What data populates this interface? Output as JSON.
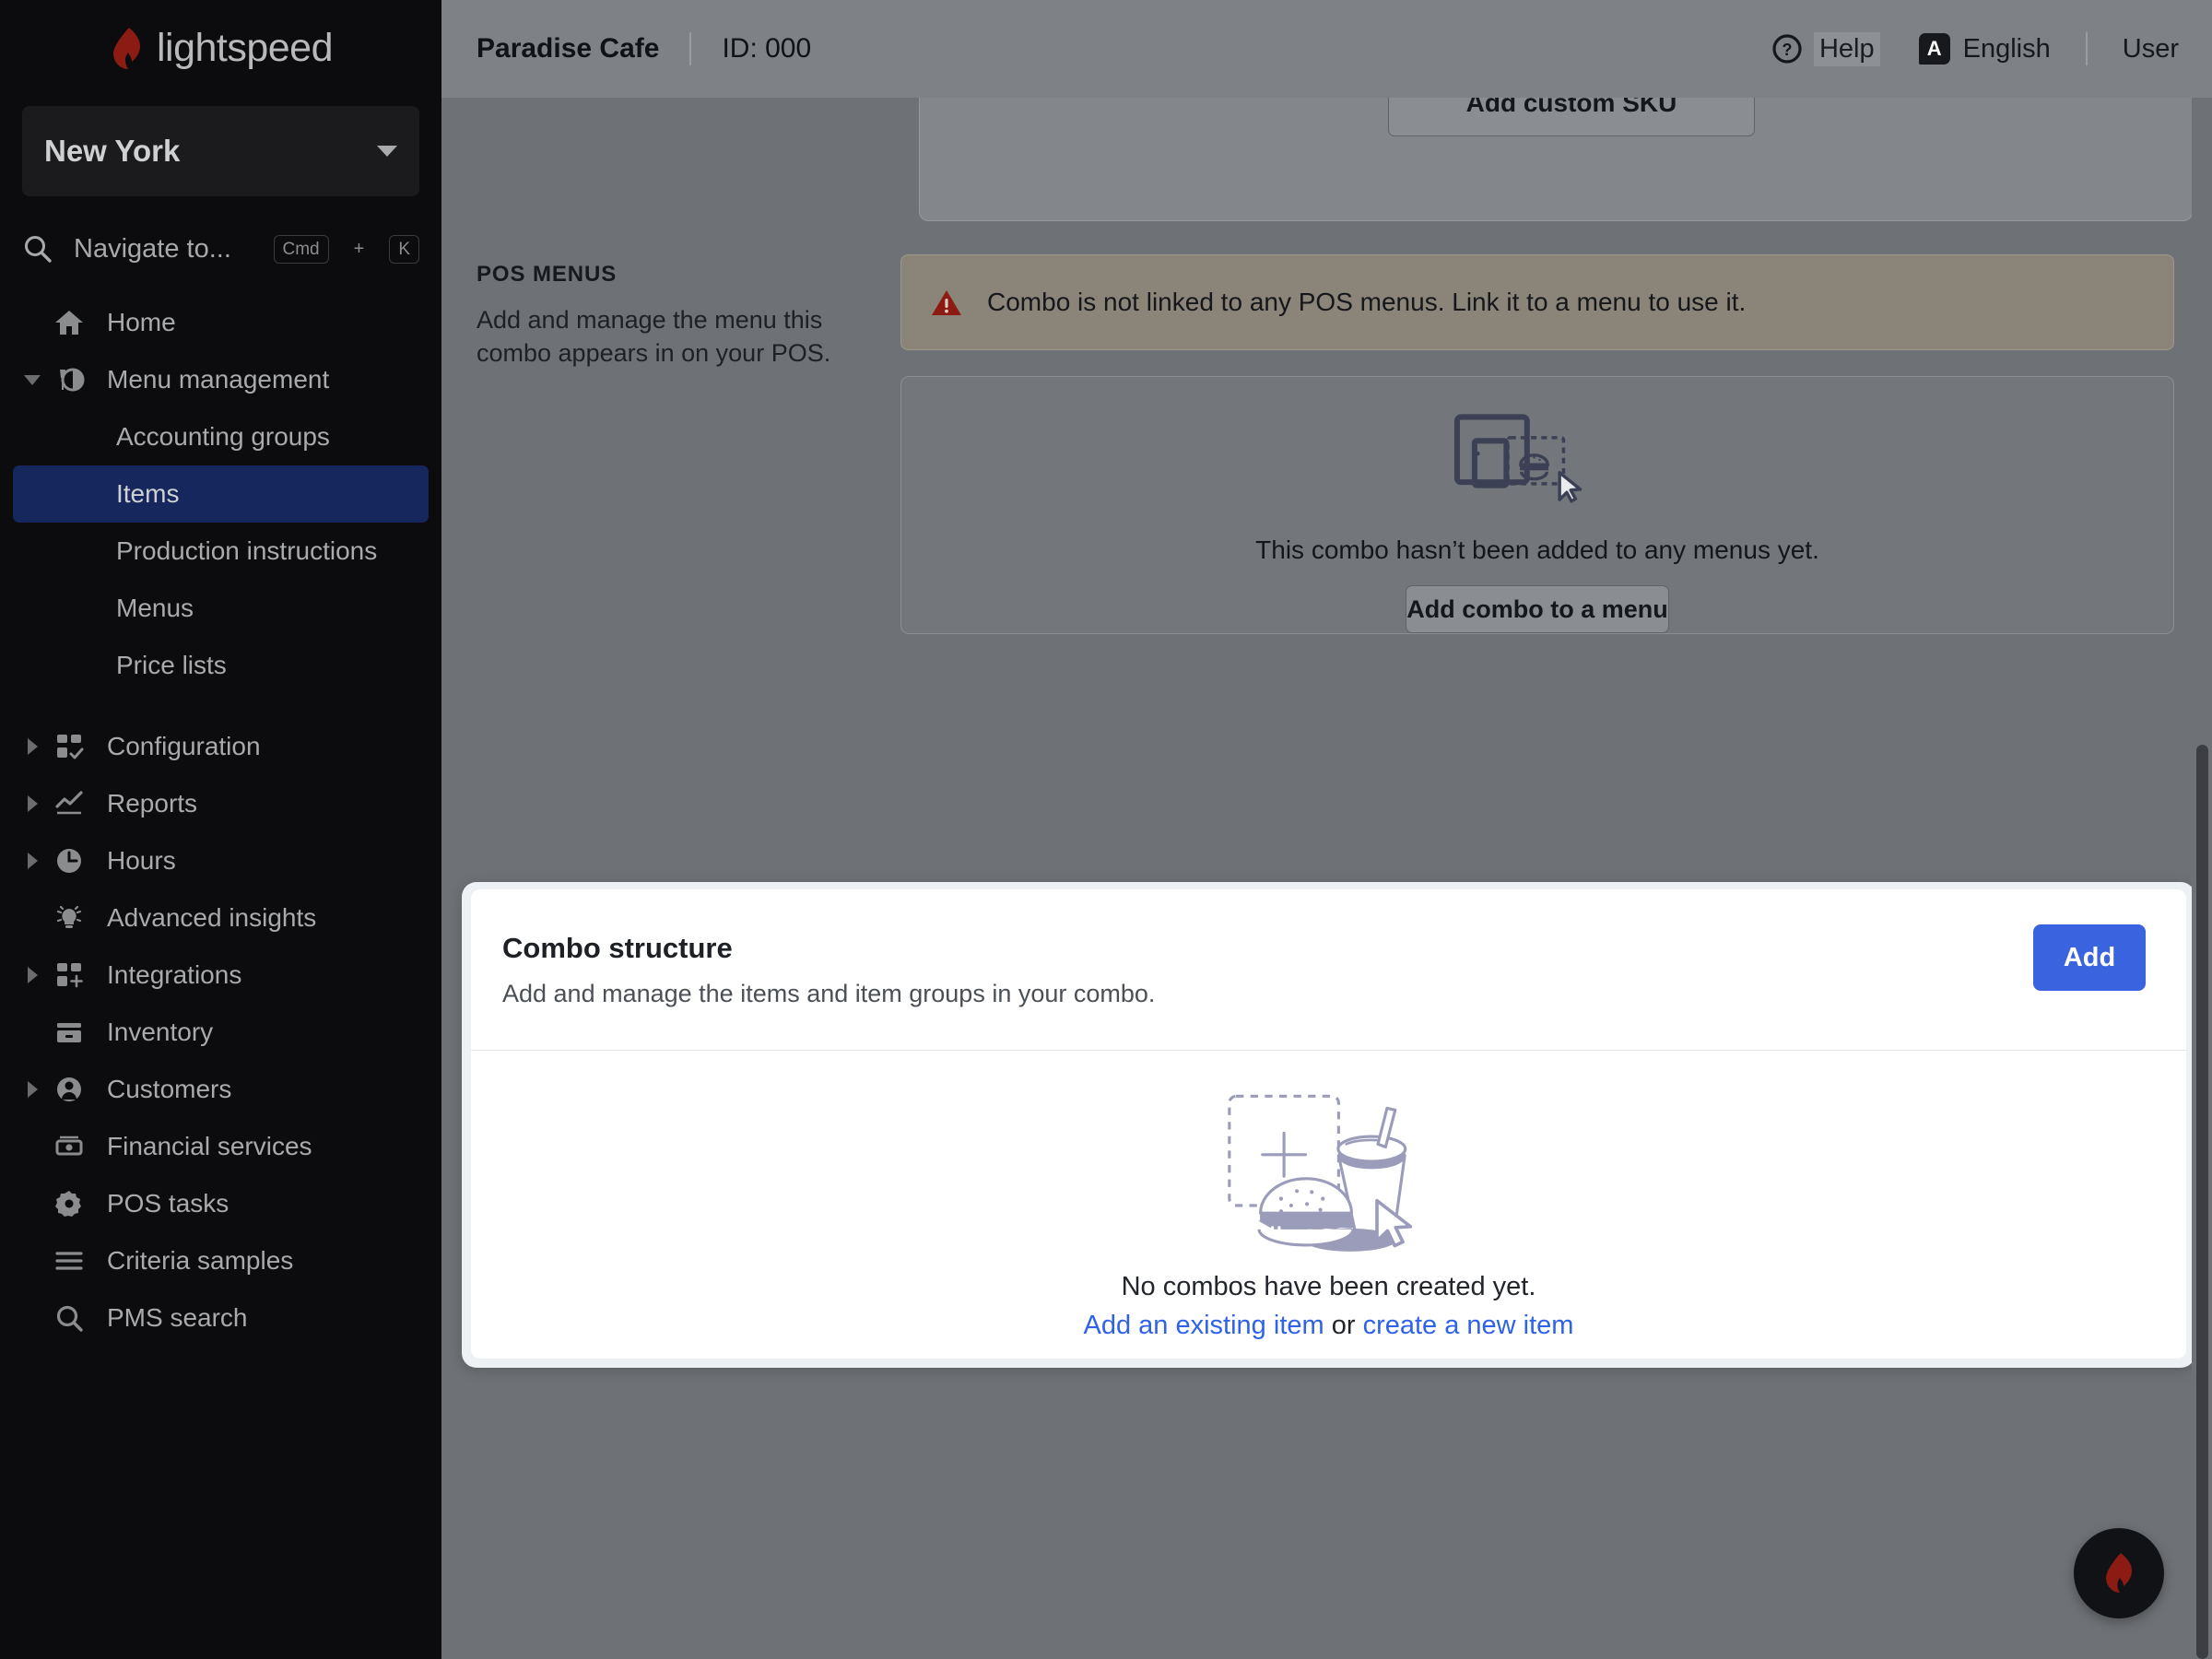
{
  "brand": {
    "name": "lightspeed",
    "flame_color": "#8c1b14",
    "accent_blue": "#3a63e0"
  },
  "sidebar": {
    "location": {
      "label": "New York",
      "caret": "chevron-down-icon"
    },
    "search": {
      "placeholder": "Navigate to...",
      "key_primary": "Cmd",
      "key_plus": "+",
      "key_secondary": "K"
    },
    "items": [
      {
        "label": "Home",
        "icon": "home-icon",
        "twisty": "none",
        "active": false,
        "sub": false
      },
      {
        "label": "Menu management",
        "icon": "menu-management-icon",
        "twisty": "down",
        "active": false,
        "sub": false
      },
      {
        "label": "Accounting groups",
        "icon": "none",
        "twisty": "none",
        "active": false,
        "sub": true
      },
      {
        "label": "Items",
        "icon": "none",
        "twisty": "none",
        "active": true,
        "sub": true
      },
      {
        "label": "Production instructions",
        "icon": "none",
        "twisty": "none",
        "active": false,
        "sub": true
      },
      {
        "label": "Menus",
        "icon": "none",
        "twisty": "none",
        "active": false,
        "sub": true
      },
      {
        "label": "Price lists",
        "icon": "none",
        "twisty": "none",
        "active": false,
        "sub": true
      },
      {
        "label": "Configuration",
        "icon": "configuration-icon",
        "twisty": "right",
        "active": false,
        "sub": false
      },
      {
        "label": "Reports",
        "icon": "reports-icon",
        "twisty": "right",
        "active": false,
        "sub": false
      },
      {
        "label": "Hours",
        "icon": "clock-icon",
        "twisty": "right",
        "active": false,
        "sub": false
      },
      {
        "label": "Advanced insights",
        "icon": "lightbulb-icon",
        "twisty": "none",
        "active": false,
        "sub": false
      },
      {
        "label": "Integrations",
        "icon": "integrations-icon",
        "twisty": "right",
        "active": false,
        "sub": false
      },
      {
        "label": "Inventory",
        "icon": "inventory-icon",
        "twisty": "none",
        "active": false,
        "sub": false
      },
      {
        "label": "Customers",
        "icon": "customers-icon",
        "twisty": "right",
        "active": false,
        "sub": false
      },
      {
        "label": "Financial services",
        "icon": "money-icon",
        "twisty": "none",
        "active": false,
        "sub": false
      },
      {
        "label": "POS tasks",
        "icon": "gear-icon",
        "twisty": "none",
        "active": false,
        "sub": false
      },
      {
        "label": "Criteria samples",
        "icon": "list-icon",
        "twisty": "none",
        "active": false,
        "sub": false
      },
      {
        "label": "PMS search",
        "icon": "search-icon",
        "twisty": "none",
        "active": false,
        "sub": false
      }
    ]
  },
  "header": {
    "store_name": "Paradise Cafe",
    "store_id": "ID: 000",
    "help_label": "Help",
    "help_icon": "question-circle-icon",
    "language_label": "English",
    "language_badge": "A",
    "user_label": "User"
  },
  "main": {
    "sku_button": "Add custom SKU",
    "pos_menus": {
      "kicker": "POS MENUS",
      "description": "Add and manage the menu this combo appears in on your POS.",
      "warning": {
        "icon": "warning-triangle-icon",
        "text": "Combo is not linked to any POS menus. Link it to a menu to use it."
      },
      "empty": {
        "illustration": "tablet-burger-icon",
        "text": "This combo hasn’t been added to any menus yet.",
        "button": "Add combo to a menu"
      }
    },
    "combo_structure": {
      "title": "Combo structure",
      "subtitle": "Add and manage the items and item groups in your combo.",
      "add_button": "Add",
      "empty": {
        "illustration": "burger-drink-cursor-icon",
        "text": "No combos have been created yet.",
        "link_existing": "Add an existing item",
        "conjunction": " or ",
        "link_new": "create a new item"
      }
    }
  },
  "fab": {
    "icon": "lightspeed-flame-icon"
  },
  "scrollbar": {
    "name": "vertical-scrollbar"
  }
}
